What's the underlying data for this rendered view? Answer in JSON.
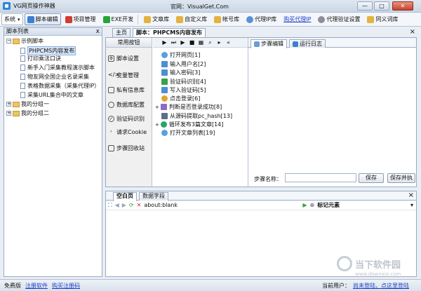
{
  "window": {
    "title": "VG网页操作神器",
    "site_label": "官网：VisualGet.Com",
    "minimize": "—",
    "maximize": "□",
    "close": "✕"
  },
  "toolbar": {
    "system": "系统",
    "script_edit": "脚本编辑",
    "project_manage": "项目管理",
    "exe_dev": "EXE开发",
    "text_lib": "文章库",
    "custom_lib": "自定义库",
    "account_lib": "帐号库",
    "proxy_ip": "代理IP库",
    "buy_proxy": "购买代理IP",
    "proxy_verify": "代理验证设置",
    "synonym_lib": "同义词库"
  },
  "left_panel": {
    "header": "脚本列表",
    "close": "x",
    "tree": {
      "root": "示例脚本",
      "children": [
        "PHPCMS内容发布",
        "打印乘法口诀",
        "新手入门采集教程演示脚本",
        "物友网全国企业名录采集",
        "表格数据采集（采集代理IP）",
        "采集URL集合中的文章"
      ],
      "groups": [
        "我的分组一",
        "我的分组二"
      ]
    }
  },
  "top_tabs": {
    "home": "主页",
    "script": "脚本：PHPCMS内容发布",
    "close": "×"
  },
  "commands": {
    "header": "常用按钮",
    "items": [
      "脚本设置",
      "变量管理",
      "私有信息库",
      "数据库配置",
      "验证码识别",
      "请求Cookie",
      "步骤回收站"
    ]
  },
  "steps": [
    "打开网页[1]",
    "输入用户名[2]",
    "输入密码[3]",
    "验证码识别[4]",
    "写入验证码[5]",
    "点击登录[6]",
    "判断是否登录成功[8]",
    "从源码提取pc_hash[13]",
    "循环发布3篇文章[14]",
    "打开文章列表[19]"
  ],
  "right_pane": {
    "tab_edit": "步骤编辑",
    "tab_log": "运行日志",
    "step_name_label": "步骤名称：",
    "step_name_value": "",
    "save_button": "保存",
    "save_and_run_button": "保存并执"
  },
  "browser": {
    "tab_blank": "空白页",
    "tab_data": "数据字段",
    "address": "about:blank",
    "mark_label": "标记元素"
  },
  "status": {
    "edition": "免费版",
    "register": "注册软件",
    "buy_code": "购买注册码",
    "current_user_label": "当前用户：",
    "login_prompt": "尚未登陆，点这里登陆"
  },
  "watermark": {
    "text": "当下软件园",
    "url": "www.downxia.com"
  },
  "colors": {
    "link": "#1a3fc9",
    "accent": "#2f86d6"
  }
}
